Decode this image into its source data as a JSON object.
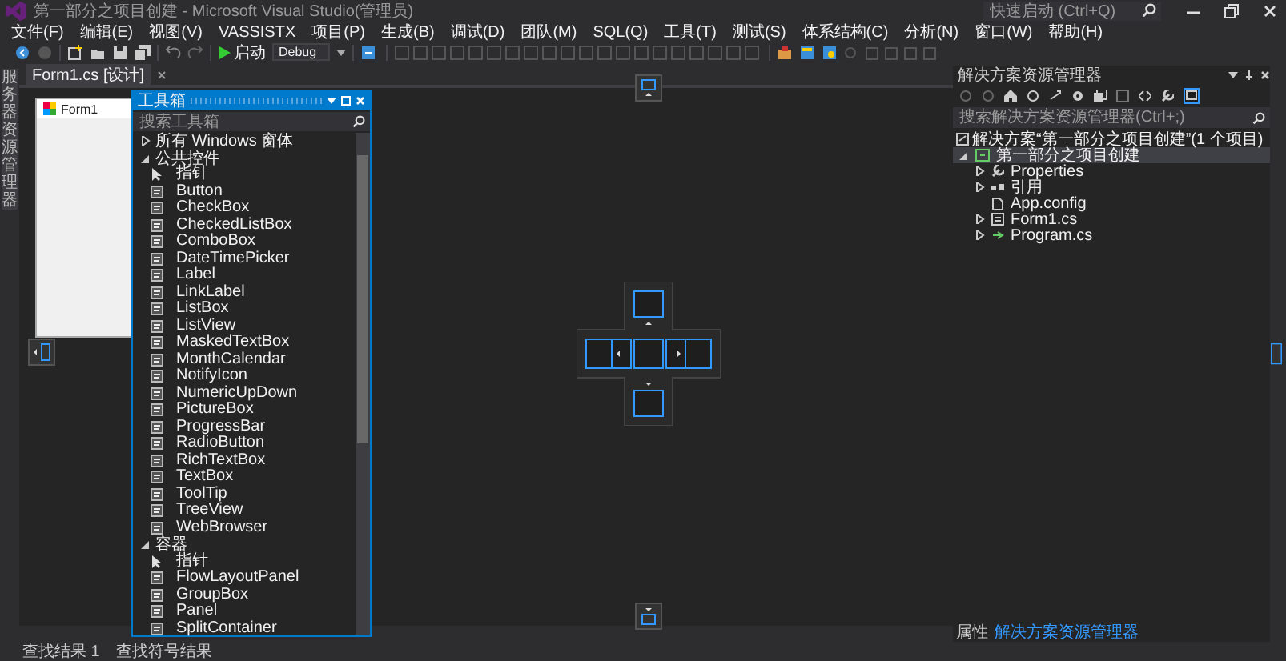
{
  "title_bar": {
    "title": "第一部分之项目创建 - Microsoft Visual Studio(管理员)",
    "quick_launch": {
      "placeholder": "快速启动 (Ctrl+Q)"
    }
  },
  "menu": [
    "文件(F)",
    "编辑(E)",
    "视图(V)",
    "VASSISTX",
    "项目(P)",
    "生成(B)",
    "调试(D)",
    "团队(M)",
    "SQL(Q)",
    "工具(T)",
    "测试(S)",
    "体系结构(C)",
    "分析(N)",
    "窗口(W)",
    "帮助(H)"
  ],
  "toolbar": {
    "start_label": "启动",
    "configuration": "Debug"
  },
  "side_tab": "服务器资源管理器",
  "document_tab": {
    "label": "Form1.cs [设计]"
  },
  "form": {
    "title": "Form1"
  },
  "toolbox": {
    "title": "工具箱",
    "search": {
      "placeholder": "搜索工具箱"
    },
    "groups": [
      {
        "label": "所有 Windows 窗体",
        "expanded": false
      },
      {
        "label": "公共控件",
        "expanded": true,
        "children": [
          {
            "label": "指针",
            "kind": "pointer"
          },
          {
            "label": "Button",
            "kind": "control"
          },
          {
            "label": "CheckBox",
            "kind": "control"
          },
          {
            "label": "CheckedListBox",
            "kind": "control"
          },
          {
            "label": "ComboBox",
            "kind": "control"
          },
          {
            "label": "DateTimePicker",
            "kind": "control"
          },
          {
            "label": "Label",
            "kind": "control"
          },
          {
            "label": "LinkLabel",
            "kind": "control"
          },
          {
            "label": "ListBox",
            "kind": "control"
          },
          {
            "label": "ListView",
            "kind": "control"
          },
          {
            "label": "MaskedTextBox",
            "kind": "control"
          },
          {
            "label": "MonthCalendar",
            "kind": "control"
          },
          {
            "label": "NotifyIcon",
            "kind": "control"
          },
          {
            "label": "NumericUpDown",
            "kind": "control"
          },
          {
            "label": "PictureBox",
            "kind": "control"
          },
          {
            "label": "ProgressBar",
            "kind": "control"
          },
          {
            "label": "RadioButton",
            "kind": "control"
          },
          {
            "label": "RichTextBox",
            "kind": "control"
          },
          {
            "label": "TextBox",
            "kind": "control"
          },
          {
            "label": "ToolTip",
            "kind": "control"
          },
          {
            "label": "TreeView",
            "kind": "control"
          },
          {
            "label": "WebBrowser",
            "kind": "control"
          }
        ]
      },
      {
        "label": "容器",
        "expanded": true,
        "children": [
          {
            "label": "指针",
            "kind": "pointer"
          },
          {
            "label": "FlowLayoutPanel",
            "kind": "control"
          },
          {
            "label": "GroupBox",
            "kind": "control"
          },
          {
            "label": "Panel",
            "kind": "control"
          },
          {
            "label": "SplitContainer",
            "kind": "control"
          }
        ]
      }
    ]
  },
  "solution_explorer": {
    "title": "解决方案资源管理器",
    "search": {
      "placeholder": "搜索解决方案资源管理器(Ctrl+;)"
    },
    "solution": "解决方案“第一部分之项目创建”(1 个项目)",
    "project": {
      "label": "第一部分之项目创建",
      "selected": true,
      "expanded": true,
      "children": [
        {
          "label": "Properties",
          "expanded": false
        },
        {
          "label": "引用",
          "expanded": false
        },
        {
          "label": "App.config"
        },
        {
          "label": "Form1.cs",
          "expanded": false
        },
        {
          "label": "Program.cs",
          "expanded": false
        }
      ]
    }
  },
  "bottom_tabs": [
    "查找结果 1",
    "查找符号结果"
  ],
  "right_bottom_tabs": [
    {
      "label": "属性",
      "selected": false
    },
    {
      "label": "解决方案资源管理器",
      "selected": true
    }
  ]
}
